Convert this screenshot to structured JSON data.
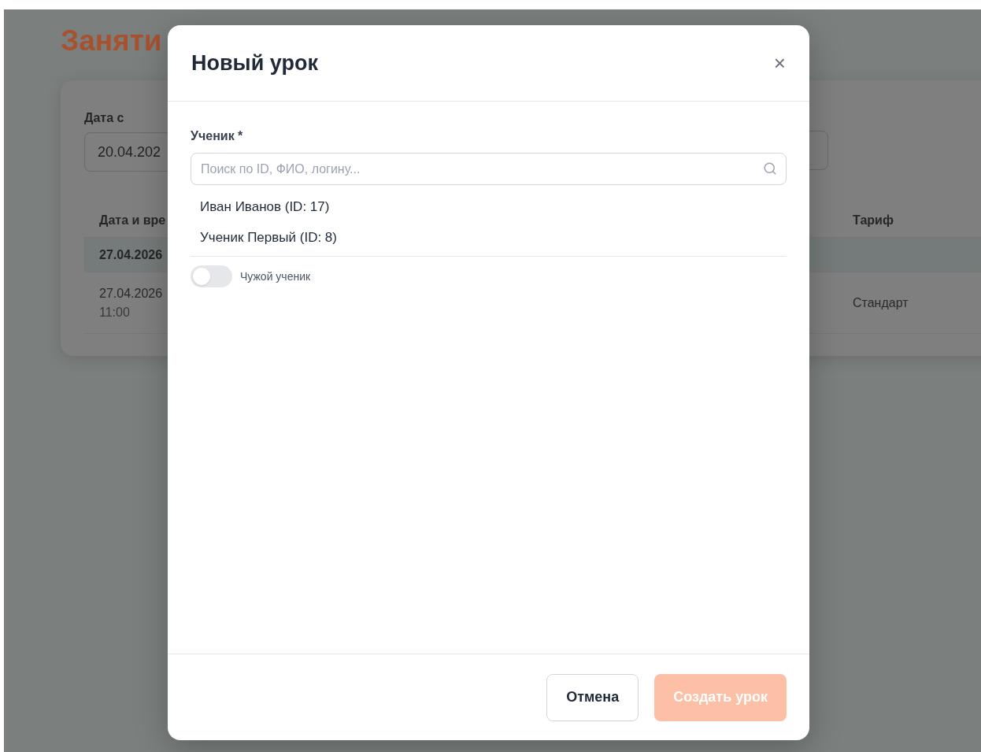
{
  "page": {
    "title": "Заняти",
    "filters": {
      "date_from": {
        "label": "Дата с",
        "value": "20.04.202"
      }
    },
    "table": {
      "columns": [
        "Дата и вре",
        "Тариф"
      ],
      "group_row": {
        "label": "27.04.2026"
      },
      "rows": [
        {
          "date": "27.04.2026",
          "time": "11:00",
          "tariff": "Стандарт"
        }
      ]
    }
  },
  "dialog": {
    "title": "Новый урок",
    "close": "×",
    "student": {
      "label": "Ученик *",
      "placeholder": "Поиск по ID, ФИО, логину...",
      "options": [
        {
          "label": "Иван Иванов (ID: 17)",
          "selected": false
        },
        {
          "label": "Ученик Первый (ID: 8)",
          "selected": false
        }
      ]
    },
    "foreign_student": {
      "label": "Чужой ученик",
      "on": false
    },
    "buttons": [
      {
        "kind": "secondary",
        "label": "Отмена",
        "disabled": false
      },
      {
        "kind": "primary",
        "label": "Создать урок",
        "disabled": true
      }
    ]
  }
}
